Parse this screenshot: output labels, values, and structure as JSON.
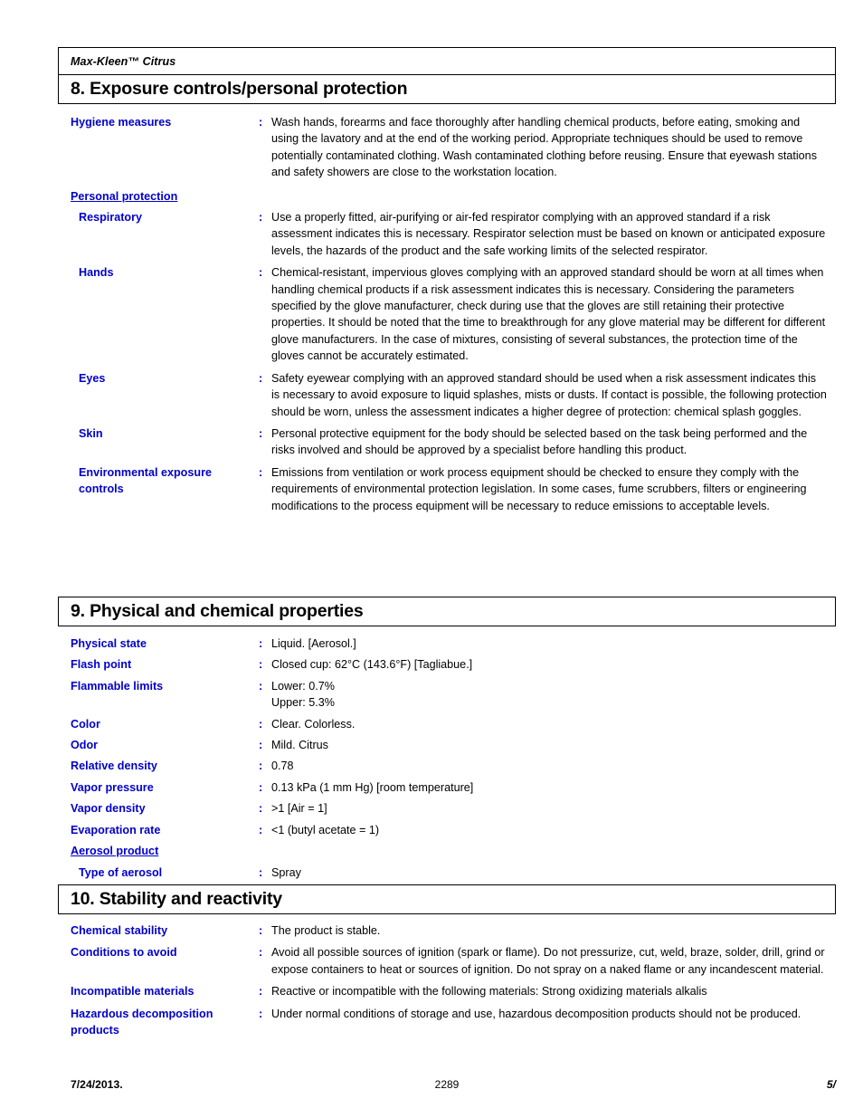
{
  "header": {
    "product_name": "Max-Kleen™ Citrus"
  },
  "sections": [
    {
      "title": "8. Exposure controls/personal protection",
      "rows": [
        {
          "label": "Hygiene measures",
          "colon": ":",
          "value": "Wash hands, forearms and face thoroughly after handling chemical products, before eating, smoking and using the lavatory and at the end of the working period.  Appropriate techniques should be used to remove potentially contaminated clothing.  Wash contaminated clothing before reusing.  Ensure that eyewash stations and safety showers are close to the workstation location."
        },
        {
          "label": "Personal protection",
          "colon": "",
          "value": ""
        },
        {
          "label": "Respiratory",
          "colon": ":",
          "value": "Use a properly fitted, air-purifying or air-fed respirator complying with an approved standard if a risk assessment indicates this is necessary.  Respirator selection must be based on known or anticipated exposure levels, the hazards of the product and the safe working limits of the selected respirator."
        },
        {
          "label": "Hands",
          "colon": ":",
          "value": "Chemical-resistant, impervious gloves complying with an approved standard should be worn at all times when handling chemical products if a risk assessment indicates this is necessary.  Considering the parameters specified by the glove manufacturer, check during use that the gloves are still retaining their protective properties.  It should be noted that the time to breakthrough for any glove material may be different for different glove manufacturers.  In the case of mixtures, consisting of several substances, the protection time of the gloves cannot be accurately estimated."
        },
        {
          "label": "Eyes",
          "colon": ":",
          "value": "Safety eyewear complying with an approved standard should be used when a risk assessment indicates this is necessary to avoid exposure to liquid splashes, mists or dusts.  If contact is possible, the following protection should be worn, unless the assessment indicates a higher degree of protection:  chemical splash goggles."
        },
        {
          "label": "Skin",
          "colon": ":",
          "value": "Personal protective equipment for the body should be selected based on the task being performed and the risks involved and should be approved by a specialist before handling this product."
        },
        {
          "label": "Environmental exposure controls",
          "colon": ":",
          "value": "Emissions from ventilation or work process equipment should be checked to ensure they comply with the requirements of environmental protection legislation.  In some cases, fume scrubbers, filters or engineering modifications to the process equipment will be necessary to reduce emissions to acceptable levels."
        }
      ]
    },
    {
      "title": "9. Physical and chemical properties",
      "rows": [
        {
          "label": "Physical state",
          "colon": ":",
          "value": "Liquid. [Aerosol.]"
        },
        {
          "label": "Flash point",
          "colon": ":",
          "value": "Closed cup: 62°C (143.6°F) [Tagliabue.]"
        },
        {
          "label": "Flammable limits",
          "colon": ":",
          "value": "Lower: 0.7%\nUpper: 5.3%"
        },
        {
          "label": "Color",
          "colon": ":",
          "value": "Clear. Colorless."
        },
        {
          "label": "Odor",
          "colon": ":",
          "value": "Mild. Citrus"
        },
        {
          "label": "Relative density",
          "colon": ":",
          "value": "0.78"
        },
        {
          "label": "Vapor pressure",
          "colon": ":",
          "value": "0.13 kPa (1 mm Hg) [room temperature]"
        },
        {
          "label": "Vapor density",
          "colon": ":",
          "value": ">1 [Air = 1]"
        },
        {
          "label": "Evaporation rate",
          "colon": ":",
          "value": "<1 (butyl acetate = 1)"
        },
        {
          "label": "Aerosol product",
          "colon": "",
          "value": ""
        },
        {
          "label": "Type of aerosol",
          "colon": ":",
          "value": "Spray"
        }
      ]
    },
    {
      "title": "10. Stability and reactivity",
      "rows": [
        {
          "label": "Chemical stability",
          "colon": ":",
          "value": "The product is stable."
        },
        {
          "label": "Conditions to avoid",
          "colon": ":",
          "value": "Avoid all possible sources of ignition (spark or flame). Do not pressurize, cut, weld, braze, solder, drill, grind or expose containers to heat or sources of ignition. Do not spray on a naked flame or any incandescent material."
        },
        {
          "label": "Incompatible materials",
          "colon": ":",
          "value": "Reactive or incompatible with the following materials: Strong oxidizing materials alkalis"
        },
        {
          "label": "Hazardous decomposition products",
          "colon": ":",
          "value": "Under normal conditions of storage and use, hazardous decomposition products should not be produced."
        }
      ]
    }
  ],
  "footer": {
    "date": "7/24/2013.",
    "center": "2289",
    "page": "5/"
  },
  "colors": {
    "label_blue": "#0000CC",
    "text_black": "#000000",
    "border": "#000000"
  }
}
